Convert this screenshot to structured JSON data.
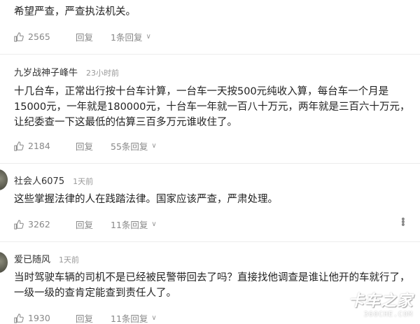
{
  "comments": [
    {
      "author": "",
      "time": "",
      "text": "希望严查，严查执法机关。",
      "likes": "2565",
      "reply_label": "回复",
      "replies_label": "1条回复"
    },
    {
      "author": "九岁战神子峰牛",
      "time": "23小时前",
      "text": "十几台车，正常出行按十台车计算，一台车一天按500元纯收入算，每台车一个月是15000元，一年就是180000元，十台车一年就一百八十万元，两年就是三百六十万元，让纪委查一下这最低的估算三百多万元谁收住了。",
      "likes": "2184",
      "reply_label": "回复",
      "replies_label": "55条回复"
    },
    {
      "author": "社会人6075",
      "time": "1天前",
      "text": "这些掌握法律的人在践踏法律。国家应该严查，严肃处理。",
      "likes": "3262",
      "reply_label": "回复",
      "replies_label": "11条回复"
    },
    {
      "author": "爱已随风",
      "time": "1天前",
      "text": "当时驾驶车辆的司机不是已经被民警带回去了吗？直接找他调查是谁让他开的车就行了，一级一级的查肯定能查到责任人了。",
      "likes": "1930",
      "reply_label": "回复",
      "replies_label": "11条回复"
    }
  ],
  "watermark": {
    "main": "卡车之家",
    "sub": "360CHE.COM"
  }
}
